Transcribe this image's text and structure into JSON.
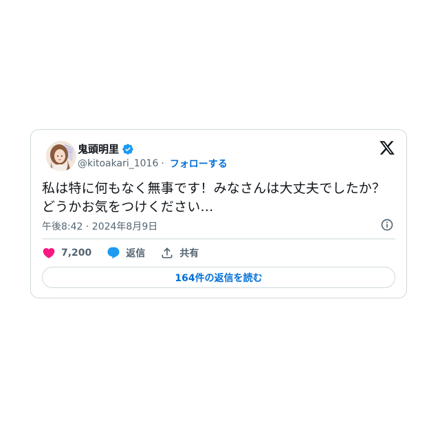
{
  "user": {
    "display_name": "鬼頭明里",
    "handle": "@kitoakari_1016",
    "separator": "·",
    "follow_label": "フォローする"
  },
  "tweet": {
    "text": "私は特に何もなく無事です！みなさんは大丈夫でしたか？どうかお気をつけください…",
    "timestamp": "午後8:42 · 2024年8月9日"
  },
  "actions": {
    "like_count": "7,200",
    "reply_label": "返信",
    "share_label": "共有"
  },
  "replies_button": {
    "label": "164件の返信を読む"
  },
  "icons": {
    "like": "heart-icon",
    "reply": "speech-bubble-icon",
    "share": "share-icon",
    "brand": "x-logo-icon",
    "info": "info-icon",
    "verified": "verified-badge-icon"
  },
  "colors": {
    "heart": "#f91880",
    "reply": "#1d9bf0",
    "link": "#006fd6",
    "secondary_text": "#536471",
    "border": "#cfd9de",
    "verified": "#1d9bf0"
  }
}
